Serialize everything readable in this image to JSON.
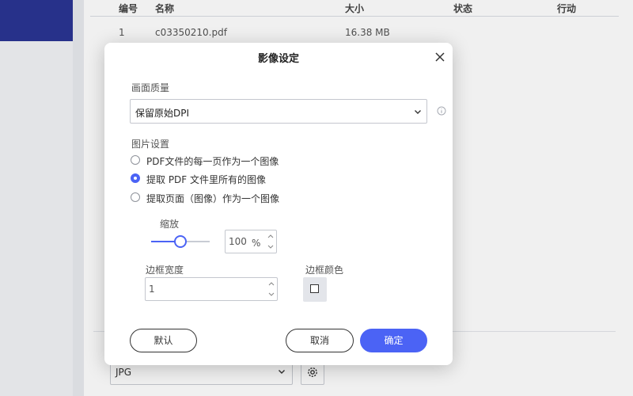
{
  "table": {
    "headers": [
      "编号",
      "名称",
      "大小",
      "状态",
      "行动"
    ],
    "rows": [
      {
        "index": "1",
        "name": "c03350210.pdf",
        "size": "16.38 MB",
        "status": "",
        "action": ""
      }
    ]
  },
  "output": {
    "format_value": "JPG",
    "settings_icon": "gear-icon"
  },
  "dialog": {
    "title": "影像设定",
    "close_icon": "close-icon",
    "quality_label": "画面质量",
    "quality_value": "保留原始DPI",
    "info_icon": "info-icon",
    "image_settings_label": "图片设置",
    "options": [
      {
        "label": "PDF文件的每一页作为一个图像",
        "selected": false
      },
      {
        "label": "提取 PDF 文件里所有的图像",
        "selected": true
      },
      {
        "label": "提取页面（图像）作为一个图像",
        "selected": false
      }
    ],
    "zoom_label": "缩放",
    "zoom_value": "100",
    "zoom_unit": "%",
    "zoom_slider_level": 0.5,
    "border_width_label": "边框宽度",
    "border_width_value": "1",
    "border_color_label": "边框颜色",
    "border_color": "#ffffff",
    "default_button": "默认",
    "cancel_button": "取消",
    "confirm_button": "确定",
    "accent_color": "#4b63f5"
  }
}
